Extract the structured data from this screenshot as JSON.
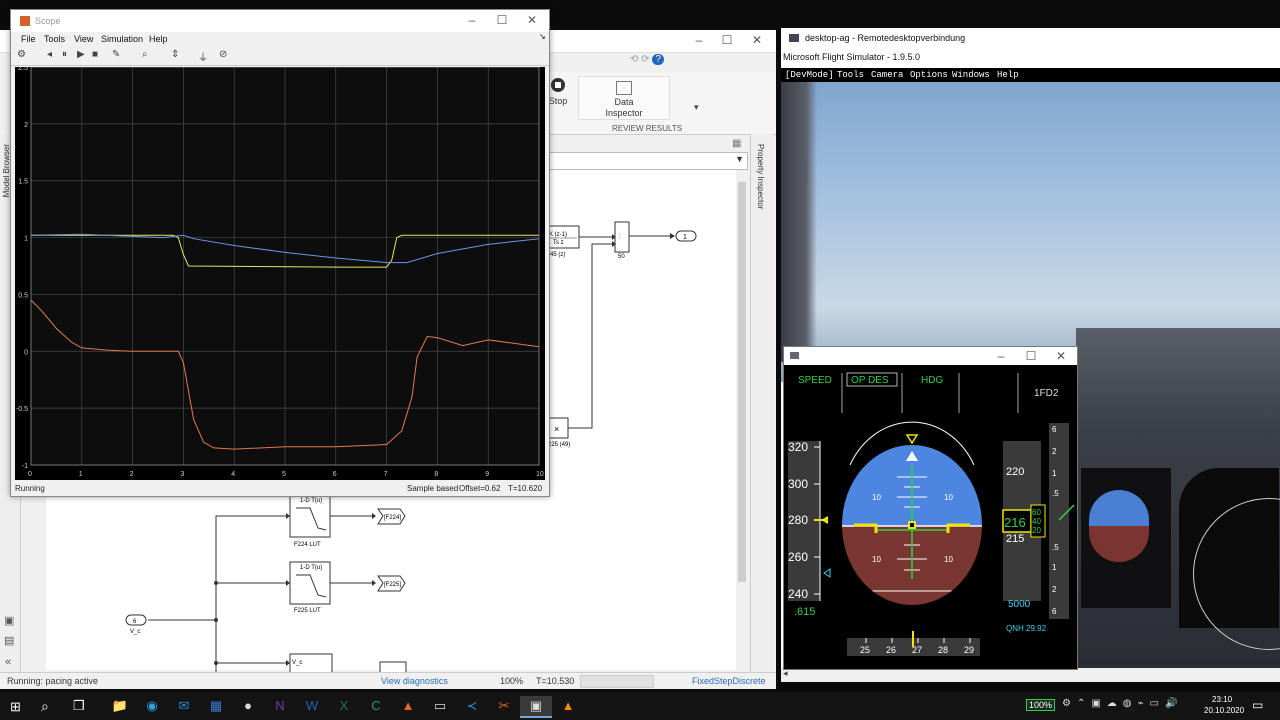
{
  "scope": {
    "title": "Scope",
    "menu": [
      "File",
      "Tools",
      "View",
      "Simulation",
      "Help"
    ],
    "toolbar_icons": [
      "settings-icon",
      "step-back-icon",
      "pause-icon",
      "play-icon",
      "stop-icon",
      "highlight-icon",
      "zoom-icon",
      "axes-scale-icon",
      "trigger-icon",
      "cursor-icon"
    ],
    "status_left": "Running",
    "status_sample": "Sample based",
    "status_offset": "Offset=0.62",
    "status_time": "T=10.620",
    "y_ticks": [
      "2.5",
      "2",
      "1.5",
      "1",
      "0.5",
      "0",
      "-0.5",
      "-1"
    ],
    "x_ticks": [
      "0",
      "1",
      "2",
      "3",
      "4",
      "5",
      "6",
      "7",
      "8",
      "9",
      "10"
    ],
    "colors": {
      "background": "#0d0d0d",
      "grid": "#4a4a4a",
      "series1": "#e6e66b",
      "series2": "#6f96dc",
      "series3": "#e07b4e"
    }
  },
  "chart_data": {
    "type": "line",
    "xlim": [
      0,
      10
    ],
    "ylim": [
      -1,
      2.5
    ],
    "grid": true,
    "series": [
      {
        "color": "#e6e66b",
        "x": [
          0,
          2.8,
          2.9,
          3.0,
          3.1,
          6.1,
          7.0,
          7.1,
          7.2,
          7.3,
          10
        ],
        "y": [
          1.02,
          1.02,
          1.0,
          0.85,
          0.75,
          0.74,
          0.74,
          0.8,
          1.0,
          1.02,
          1.02
        ]
      },
      {
        "color": "#6f96dc",
        "x": [
          0,
          1,
          2,
          2.6,
          3.0,
          3.2,
          4,
          5,
          6,
          7,
          7.4,
          8,
          9,
          10
        ],
        "y": [
          1.02,
          1.03,
          1.01,
          1.0,
          1.02,
          0.99,
          0.93,
          0.87,
          0.82,
          0.78,
          0.78,
          0.86,
          0.94,
          0.99
        ]
      },
      {
        "color": "#e07b4e",
        "x": [
          0,
          0.2,
          0.5,
          0.8,
          1.0,
          1.5,
          2.0,
          2.9,
          3.0,
          3.2,
          3.4,
          3.6,
          4,
          5,
          6,
          7.0,
          7.3,
          7.5,
          7.6,
          7.8,
          8.0,
          8.5,
          9,
          10
        ],
        "y": [
          0.45,
          0.36,
          0.2,
          0.08,
          0.03,
          0.01,
          0.0,
          0.0,
          -0.1,
          -0.6,
          -0.8,
          -0.85,
          -0.86,
          -0.84,
          -0.84,
          -0.82,
          -0.7,
          -0.4,
          -0.05,
          0.13,
          0.12,
          0.05,
          0.1,
          0.04
        ]
      }
    ]
  },
  "simulink": {
    "toolbar_stop": "Stop",
    "data_inspector": "Data Inspector",
    "review_results": "REVIEW RESULTS",
    "side_tab_left": "Model Browser",
    "side_tab_right": "Property Inspector",
    "block_tf_num": "K (z-1)",
    "block_tf_den": "Ts z",
    "block_tf_label": "45 (z)",
    "block_product_label": "50",
    "block_outport": "1",
    "block_mult_symbol": "×",
    "block_mult_label": "225 (49)",
    "lut1_title": "1-D T(u)",
    "lut1_label": "F224 LUT",
    "lut1_goto": "[F224]",
    "lut2_title": "1-D T(u)",
    "lut2_label": "F225 LUT",
    "lut2_goto": "[F225]",
    "lut3_title": "V_c",
    "inport_num": "6",
    "inport_label": "V_c",
    "status_left": "Running: pacing active",
    "status_diag": "View diagnostics",
    "status_zoom": "100%",
    "status_time": "T=10.530",
    "status_solver": "FixedStepDiscrete"
  },
  "rdp": {
    "title": "desktop-ag - Remotedesktopverbindung",
    "app_title": "Microsoft Flight Simulator - 1.9.5.0",
    "menu": [
      "[DevMode]",
      "Tools",
      "Camera",
      "Options",
      "Windows",
      "Help"
    ]
  },
  "pfd": {
    "fma": [
      "SPEED",
      "OP DES",
      "HDG",
      "",
      "1FD2"
    ],
    "speed_ticks": [
      "320",
      "300",
      "280",
      "260",
      "240"
    ],
    "alt_ticks": [
      "220",
      "215"
    ],
    "alt_current": "216",
    "alt_drum": [
      "60",
      "40",
      "20"
    ],
    "alt_target": "5000",
    "mach": ".615",
    "qnh": "QNH 29.92",
    "pitch_labels": [
      "10",
      "10",
      "10",
      "10"
    ],
    "heading_ticks": [
      "25",
      "26",
      "27",
      "28",
      "29"
    ],
    "vs_ticks": [
      "6",
      "2",
      "1",
      ".5",
      ".5",
      "1",
      "2",
      "6"
    ]
  },
  "taskbar": {
    "apps": [
      "explorer-icon",
      "edge-icon",
      "mail-icon",
      "calculator-icon",
      "apple-icon",
      "onenote-icon",
      "word-icon",
      "excel-icon",
      "cheat-icon",
      "matlab-icon",
      "terminal-icon",
      "vscode-icon",
      "snipping-icon",
      "remote-desktop-icon",
      "vlc-icon"
    ],
    "battery": "100%",
    "time": "23:10",
    "date": "20.10.2020"
  }
}
